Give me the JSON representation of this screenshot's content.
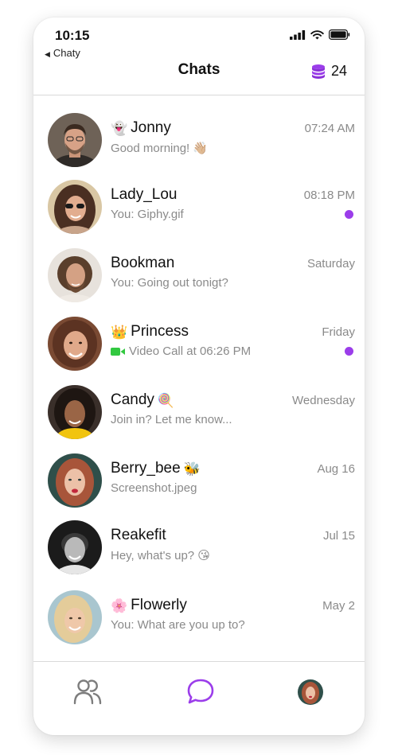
{
  "status_bar": {
    "time": "10:15"
  },
  "nav": {
    "back_label": "Chaty",
    "title": "Chats",
    "coin_count": "24"
  },
  "colors": {
    "accent": "#9b3dea",
    "muted_text": "#8a8a8a",
    "video_green": "#32c840",
    "divider": "#d9d9d9"
  },
  "chats": [
    {
      "name": "Jonny",
      "name_emoji": "👻",
      "time": "07:24 AM",
      "preview": "Good morning! 👋🏼",
      "unread": false
    },
    {
      "name": "Lady_Lou",
      "name_emoji": "",
      "time": "08:18 PM",
      "preview": "You: Giphy.gif",
      "unread": true
    },
    {
      "name": "Bookman",
      "name_emoji": "",
      "time": "Saturday",
      "preview": "You: Going out tonigt?",
      "unread": false
    },
    {
      "name": "Princess",
      "name_emoji": "👑",
      "time": "Friday",
      "preview": "Video Call at 06:26 PM",
      "preview_icon": "video-camera-icon",
      "unread": true
    },
    {
      "name": "Candy",
      "name_emoji_after": "🍭",
      "time": "Wednesday",
      "preview": "Join in? Let me know...",
      "unread": false
    },
    {
      "name": "Berry_bee",
      "name_emoji_after": "🐝",
      "time": "Aug 16",
      "preview": "Screenshot.jpeg",
      "unread": false
    },
    {
      "name": "Reakefit",
      "name_emoji": "",
      "time": "Jul 15",
      "preview": "Hey, what's up? 😘",
      "unread": false
    },
    {
      "name": "Flowerly",
      "name_emoji": "🌸",
      "time": "May 2",
      "preview": "You: What are you up to?",
      "unread": false
    }
  ],
  "tabs": [
    {
      "icon": "friends-icon",
      "active": false
    },
    {
      "icon": "chat-bubble-icon",
      "active": true
    },
    {
      "icon": "profile-avatar",
      "active": false
    }
  ]
}
